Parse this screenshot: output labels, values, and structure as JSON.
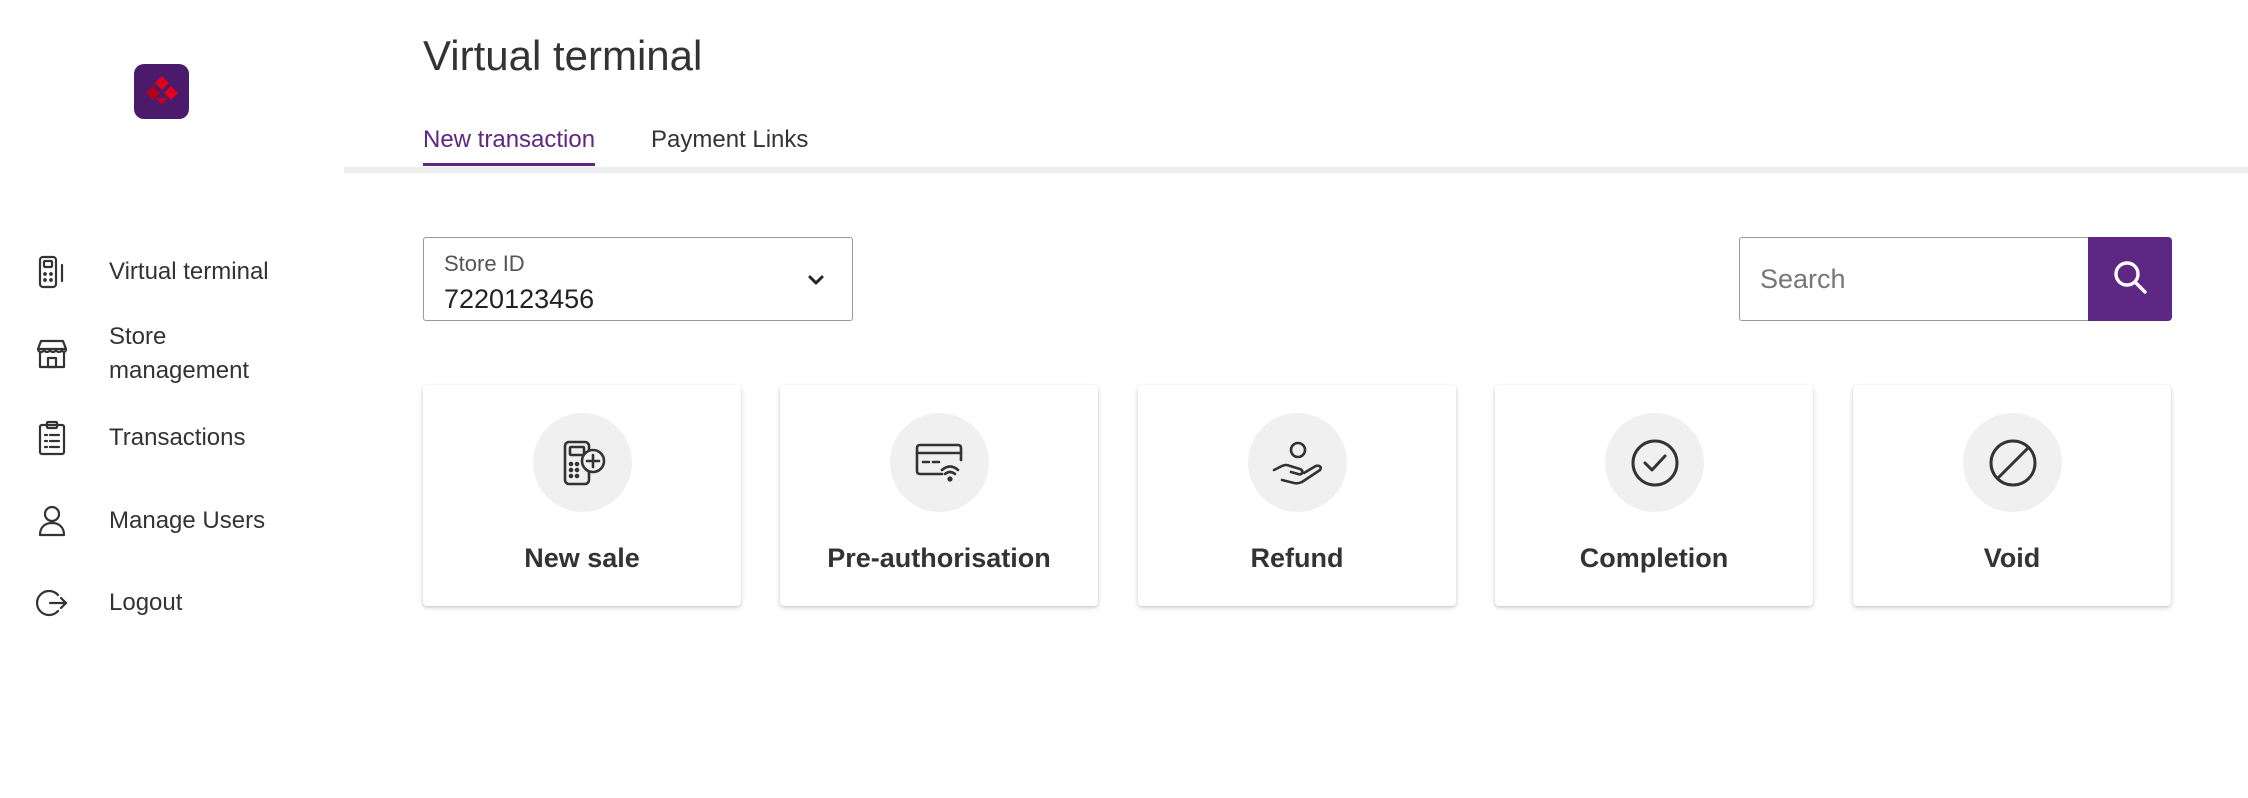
{
  "app": {
    "title": "Virtual terminal",
    "accent_color": "#5e2784",
    "logo_icon": "brand-logo-icon"
  },
  "sidebar": {
    "items": [
      {
        "label": "Virtual terminal",
        "icon": "card-terminal-icon"
      },
      {
        "label": "Store management",
        "icon": "store-icon"
      },
      {
        "label": "Transactions",
        "icon": "clipboard-icon"
      },
      {
        "label": "Manage Users",
        "icon": "user-icon"
      },
      {
        "label": "Logout",
        "icon": "logout-icon"
      }
    ]
  },
  "tabs": [
    {
      "label": "New transaction",
      "active": true
    },
    {
      "label": "Payment Links",
      "active": false
    }
  ],
  "store": {
    "label": "Store ID",
    "value": "7220123456"
  },
  "search": {
    "placeholder": "Search",
    "icon": "search-icon"
  },
  "cards": [
    {
      "label": "New sale",
      "icon": "new-sale-icon"
    },
    {
      "label": "Pre-authorisation",
      "icon": "contactless-card-icon"
    },
    {
      "label": "Refund",
      "icon": "refund-hand-icon"
    },
    {
      "label": "Completion",
      "icon": "check-circle-icon"
    },
    {
      "label": "Void",
      "icon": "void-icon"
    }
  ]
}
